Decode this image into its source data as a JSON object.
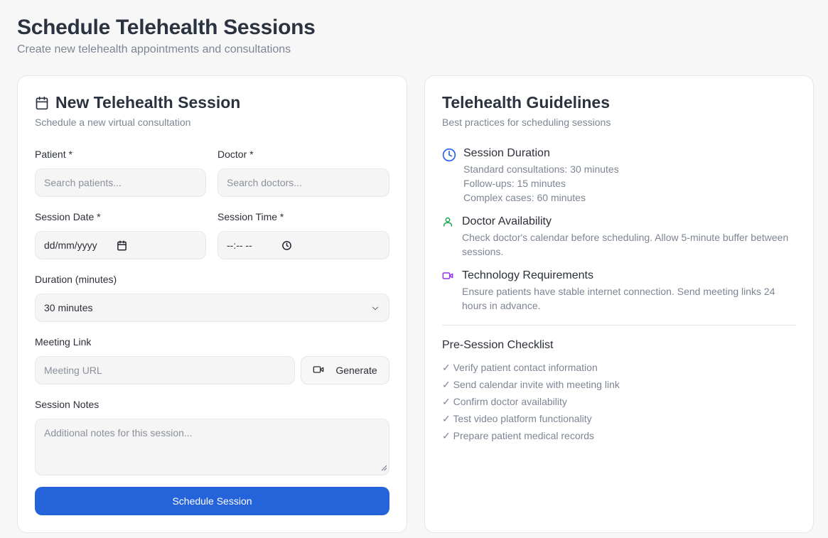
{
  "header": {
    "title": "Schedule Telehealth Sessions",
    "subtitle": "Create new telehealth appointments and consultations"
  },
  "form": {
    "title": "New Telehealth Session",
    "description": "Schedule a new virtual consultation",
    "patient_label": "Patient *",
    "patient_placeholder": "Search patients...",
    "doctor_label": "Doctor *",
    "doctor_placeholder": "Search doctors...",
    "date_label": "Session Date *",
    "date_value": "dd/mm/yyyy",
    "time_label": "Session Time *",
    "time_value": "--:-- --",
    "duration_label": "Duration (minutes)",
    "duration_selected": "30 minutes",
    "link_label": "Meeting Link",
    "link_placeholder": "Meeting URL",
    "generate_label": "Generate",
    "notes_label": "Session Notes",
    "notes_placeholder": "Additional notes for this session...",
    "submit_label": "Schedule Session",
    "icons": {
      "title": "calendar-icon",
      "date": "calendar-icon",
      "time": "clock-icon",
      "duration": "chevron-down-icon",
      "generate": "video-icon"
    }
  },
  "guidelines": {
    "title": "Telehealth Guidelines",
    "description": "Best practices for scheduling sessions",
    "items": [
      {
        "icon": "clock-icon",
        "color": "#2563eb",
        "title": "Session Duration",
        "lines": [
          "Standard consultations: 30 minutes",
          "Follow-ups: 15 minutes",
          "Complex cases: 60 minutes"
        ]
      },
      {
        "icon": "user-icon",
        "color": "#16a34a",
        "title": "Doctor Availability",
        "lines": [
          "Check doctor's calendar before scheduling. Allow 5-minute buffer between",
          "sessions."
        ]
      },
      {
        "icon": "video-icon",
        "color": "#9333ea",
        "title": "Technology Requirements",
        "lines": [
          "Ensure patients have stable internet connection. Send meeting links 24",
          "hours in advance."
        ]
      }
    ],
    "checklist_title": "Pre-Session Checklist",
    "checklist": [
      "✓ Verify patient contact information",
      "✓ Send calendar invite with meeting link",
      "✓ Confirm doctor availability",
      "✓ Test video platform functionality",
      "✓ Prepare patient medical records"
    ]
  },
  "colors": {
    "primary": "#2563db",
    "background": "#f7f7f7",
    "muted_text": "#7d8594"
  }
}
